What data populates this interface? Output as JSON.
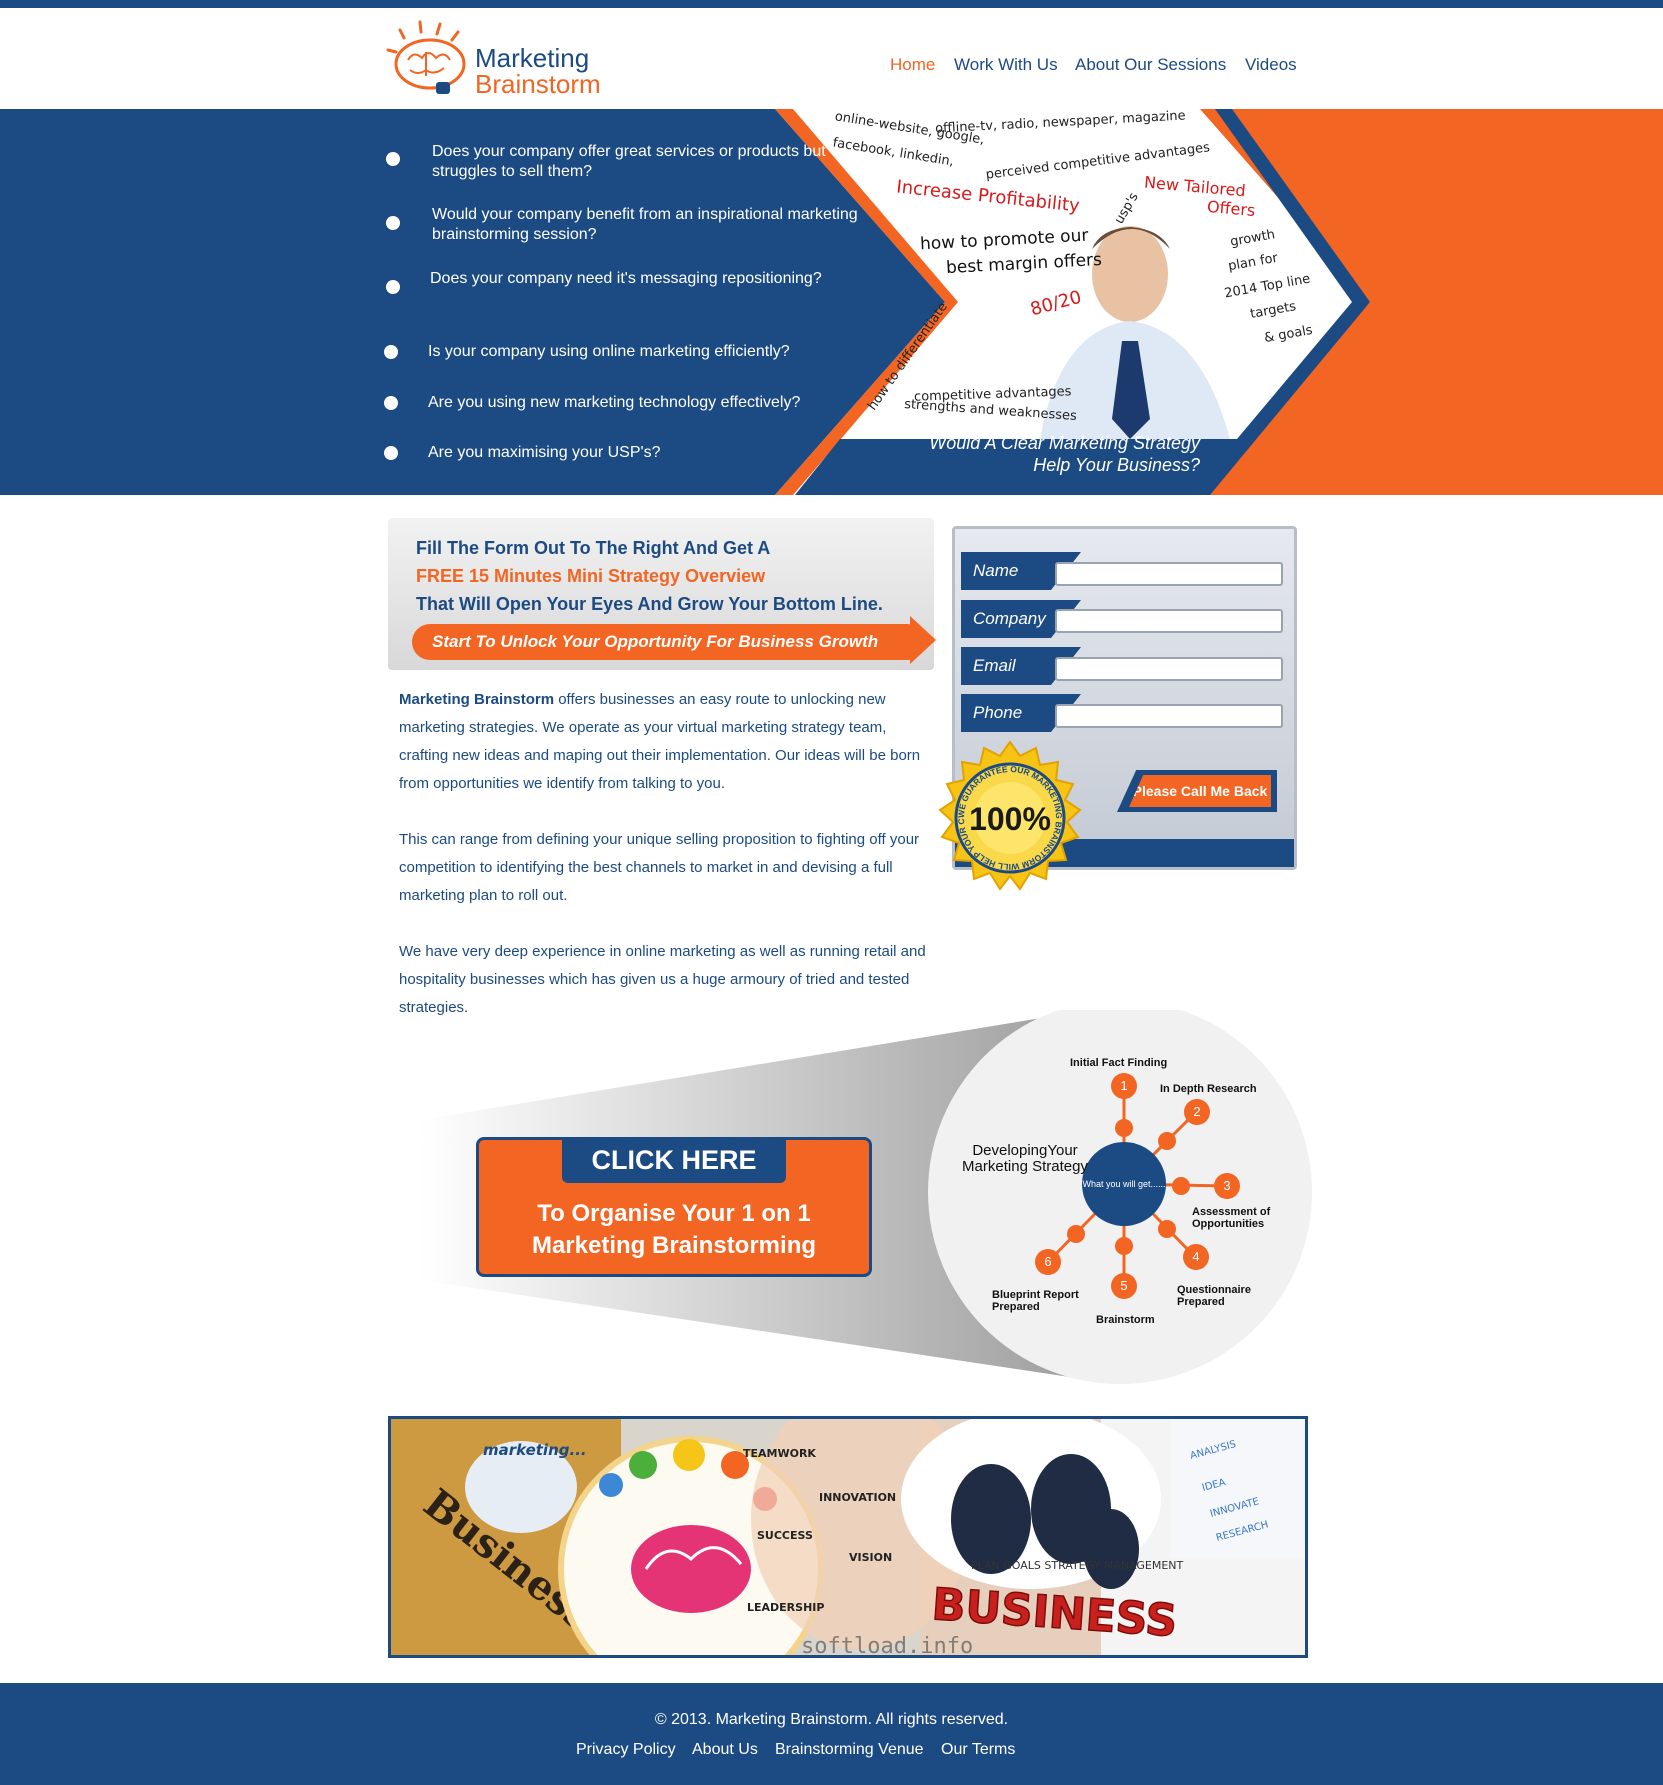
{
  "brand": {
    "line1": "Marketing",
    "line2": "Brainstorm"
  },
  "nav": [
    "Home",
    "Work With Us",
    "About Our Sessions",
    "Videos"
  ],
  "hero": {
    "questions": [
      "Does your company offer great services or products but struggles to sell them?",
      "Would your company benefit from an inspirational marketing brainstorming session?",
      "Does your company need it's messaging repositioning?",
      "Is your company using online marketing efficiently?",
      "Are you using new marketing technology effectively?",
      "Are you maximising your USP's?"
    ],
    "notes": {
      "online": "online-website, google,",
      "offline": "offline-tv, radio, newspaper, magazine",
      "facebook": "facebook, linkedin,",
      "perceived": "perceived competitive advantages",
      "increase": "Increase Profitability",
      "usps": "usp's",
      "tailored1": "New Tailored",
      "tailored2": "Offers",
      "promote1": "how to promote our",
      "promote2": "best margin offers",
      "growth1": "growth",
      "growth2": "plan for",
      "growth3": "2014 Top line",
      "growth4": "targets",
      "growth5": "& goals",
      "ratio": "80/20",
      "differentiate": "how to differentiate",
      "comp1": "competitive advantages",
      "comp2": "strengths and weaknesses"
    },
    "cta1": "Would A Clear Marketing Strategy",
    "cta2": "Help Your Business?"
  },
  "offer": {
    "line1": "Fill The Form Out To The Right And Get A",
    "line2": "FREE 15 Minutes Mini Strategy Overview",
    "line3": "That Will Open Your Eyes And Grow Your Bottom Line.",
    "button": "Start To Unlock Your Opportunity For Business Growth"
  },
  "form": {
    "fields": [
      "Name",
      "Company",
      "Email",
      "Phone"
    ],
    "submit": "Please Call Me Back",
    "seal_text": "WE GUARANTEE OUR MARKETING BRAINSTORM WILL HELP YOUR COMPANY",
    "seal_pct": "100%"
  },
  "body": {
    "brand": "Marketing Brainstorm",
    "p1": " offers businesses an easy route to unlocking new marketing strategies. We operate as your virtual marketing strategy team, crafting new ideas and maping out their implementation. Our ideas will be born from opportunities we identify from talking to you.",
    "p2": "This can range from defining your unique selling proposition to fighting off your competition to identifying the best channels to market in and devising a full marketing plan to roll out.",
    "p3": "We have very deep experience in online marketing as well as running retail and hospitality businesses which has given us a huge armoury of tried and tested strategies."
  },
  "cta": {
    "tab": "CLICK HERE",
    "line1": "To Organise Your 1 on 1",
    "line2": "Marketing Brainstorming"
  },
  "process": {
    "title": "DevelopingYour Marketing Strategy",
    "center": "What you will get......",
    "steps": [
      {
        "n": "1",
        "label": "Initial Fact Finding"
      },
      {
        "n": "2",
        "label": "In Depth Research"
      },
      {
        "n": "3",
        "label": "Assessment of Opportunities"
      },
      {
        "n": "4",
        "label": "Questionnaire Prepared"
      },
      {
        "n": "5",
        "label": "Brainstorm"
      },
      {
        "n": "6",
        "label": "Blueprint Report Prepared"
      }
    ]
  },
  "banner": {
    "plan": "Business Plan",
    "marketing": "marketing...",
    "words": [
      "TEAMWORK",
      "INNOVATION",
      "VISION",
      "LEADERSHIP",
      "SUCCESS"
    ],
    "chart_words": [
      "ANALYSIS",
      "IDEA",
      "INNOVATE",
      "RESEARCH"
    ],
    "business": "BUSINESS",
    "cloud": "PLAN GOALS STRATEGY MANAGEMENT",
    "watermark": "softload.info"
  },
  "footer": {
    "copyright": "© 2013. Marketing Brainstorm. All rights reserved.",
    "links": [
      "Privacy Policy",
      "About Us",
      "Brainstorming Venue",
      "Our Terms"
    ]
  },
  "colors": {
    "blue": "#1c4a82",
    "orange": "#f26522"
  }
}
